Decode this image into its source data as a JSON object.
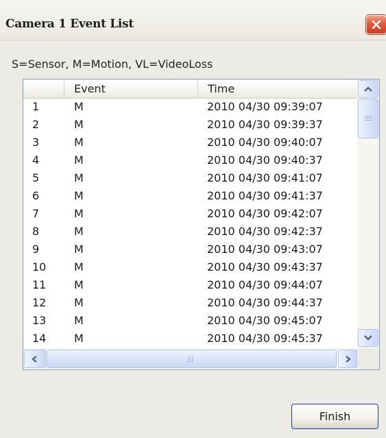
{
  "window": {
    "title": "Camera 1  Event List",
    "close_icon": "close-x-icon"
  },
  "legend": "S=Sensor, M=Motion, VL=VideoLoss",
  "table": {
    "columns": [
      "",
      "Event",
      "Time"
    ],
    "rows": [
      [
        "1",
        "M",
        "2010 04/30 09:39:07"
      ],
      [
        "2",
        "M",
        "2010 04/30 09:39:37"
      ],
      [
        "3",
        "M",
        "2010 04/30 09:40:07"
      ],
      [
        "4",
        "M",
        "2010 04/30 09:40:37"
      ],
      [
        "5",
        "M",
        "2010 04/30 09:41:07"
      ],
      [
        "6",
        "M",
        "2010 04/30 09:41:37"
      ],
      [
        "7",
        "M",
        "2010 04/30 09:42:07"
      ],
      [
        "8",
        "M",
        "2010 04/30 09:42:37"
      ],
      [
        "9",
        "M",
        "2010 04/30 09:43:07"
      ],
      [
        "10",
        "M",
        "2010 04/30 09:43:37"
      ],
      [
        "11",
        "M",
        "2010 04/30 09:44:07"
      ],
      [
        "12",
        "M",
        "2010 04/30 09:44:37"
      ],
      [
        "13",
        "M",
        "2010 04/30 09:45:07"
      ],
      [
        "14",
        "M",
        "2010 04/30 09:45:37"
      ]
    ]
  },
  "buttons": {
    "finish_label": "Finish"
  },
  "colors": {
    "close_button": "#e2583a",
    "grid_border": "#7f9db9",
    "scrollbar": "#c9d7f5",
    "button_border": "#1c3f94"
  }
}
